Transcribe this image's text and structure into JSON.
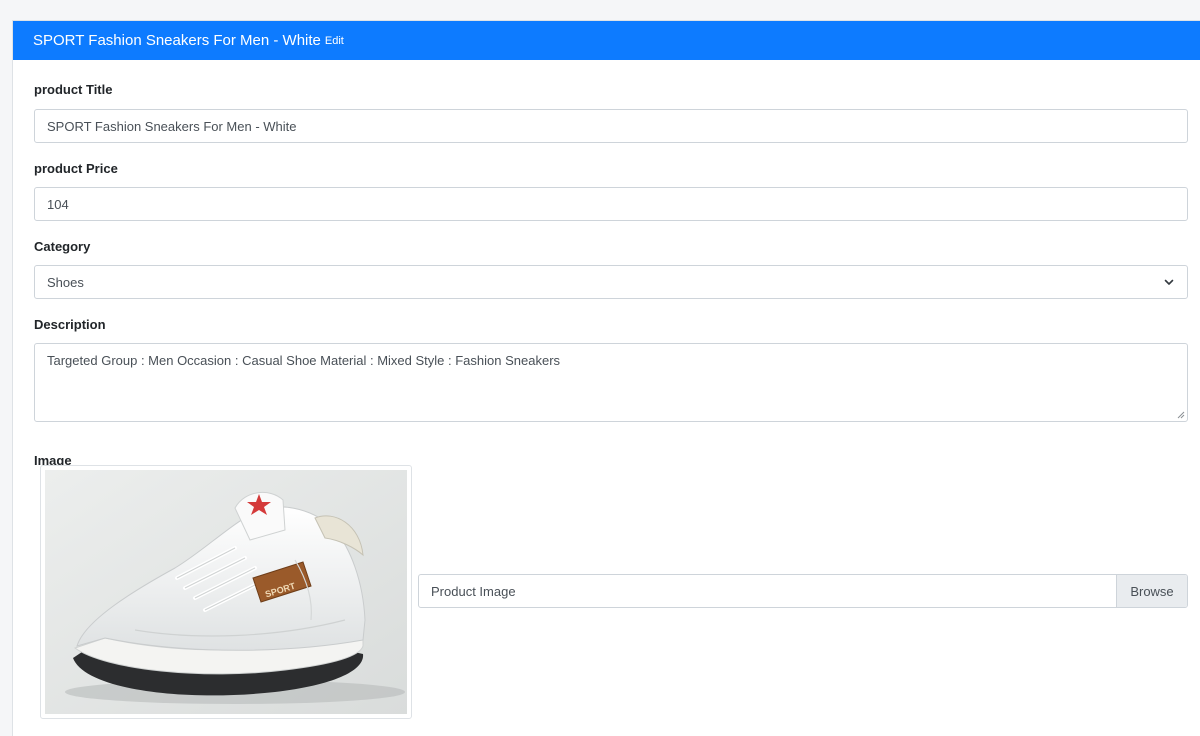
{
  "header": {
    "title": "SPORT Fashion Sneakers For Men - White",
    "edit_label": "Edit"
  },
  "form": {
    "title": {
      "label": "product Title",
      "value": "SPORT Fashion Sneakers For Men - White"
    },
    "price": {
      "label": "product Price",
      "value": "104"
    },
    "category": {
      "label": "Category",
      "selected": "Shoes"
    },
    "description": {
      "label": "Description",
      "value": "Targeted Group : Men Occasion : Casual Shoe Material : Mixed Style : Fashion Sneakers"
    },
    "image": {
      "label": "Image",
      "shoe_brand_text": "SPORT",
      "file_placeholder": "Product Image",
      "browse_label": "Browse"
    }
  },
  "colors": {
    "header_bg": "#0d7bff",
    "header_text": "#ffffff",
    "input_border": "#ced4da",
    "browse_bg": "#e9ecef"
  },
  "icons": {
    "select_arrow": "chevron-down-icon",
    "textarea_grip": "resize-grip-icon"
  }
}
